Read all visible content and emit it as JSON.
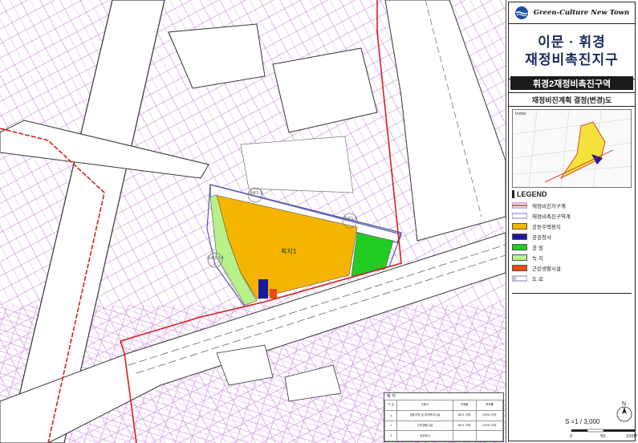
{
  "brand": {
    "name": "Green-Culture New Town"
  },
  "district": {
    "line1": "이문 · 휘경",
    "line2": "재정비촉진지구"
  },
  "zone": {
    "title": "휘경2재정비촉진구역"
  },
  "plan": {
    "title": "재정비진계획 결정(변경)도"
  },
  "index": {
    "label": "Index"
  },
  "legend": {
    "title": "LEGEND",
    "items": [
      {
        "label": "재정비진지구계",
        "color": "#d42020"
      },
      {
        "label": "재정비촉진구역계",
        "color": "#5a5ab0"
      },
      {
        "label": "공동주택용지",
        "color": "#f5b400"
      },
      {
        "label": "공공청사",
        "color": "#1a1a9c"
      },
      {
        "label": "공 원",
        "color": "#22cc22"
      },
      {
        "label": "녹 지",
        "color": "#b8f08a"
      },
      {
        "label": "근린생활시설",
        "color": "#e84a10"
      },
      {
        "label": "도 로",
        "color": "#ffffff"
      }
    ]
  },
  "map": {
    "parcel_label": "획지1",
    "road_labels": [
      "중로1-1",
      "중로1-1",
      "중로1-14"
    ],
    "table": {
      "title": "획 지",
      "headers": [
        "구 분",
        "주용도",
        "건폐율",
        "용적률"
      ],
      "rows": [
        [
          "1",
          "공동주택 및 부대복리시설",
          "60% 이하",
          "200% 이하"
        ],
        [
          "2",
          "근린생활시설",
          "60% 이하",
          "200% 이하"
        ],
        [
          "3",
          "공공청사",
          "",
          ""
        ]
      ]
    }
  },
  "scale": {
    "text": "S =1 / 3,000",
    "bar_labels": [
      "0",
      "50",
      "100M"
    ],
    "north": "N"
  }
}
